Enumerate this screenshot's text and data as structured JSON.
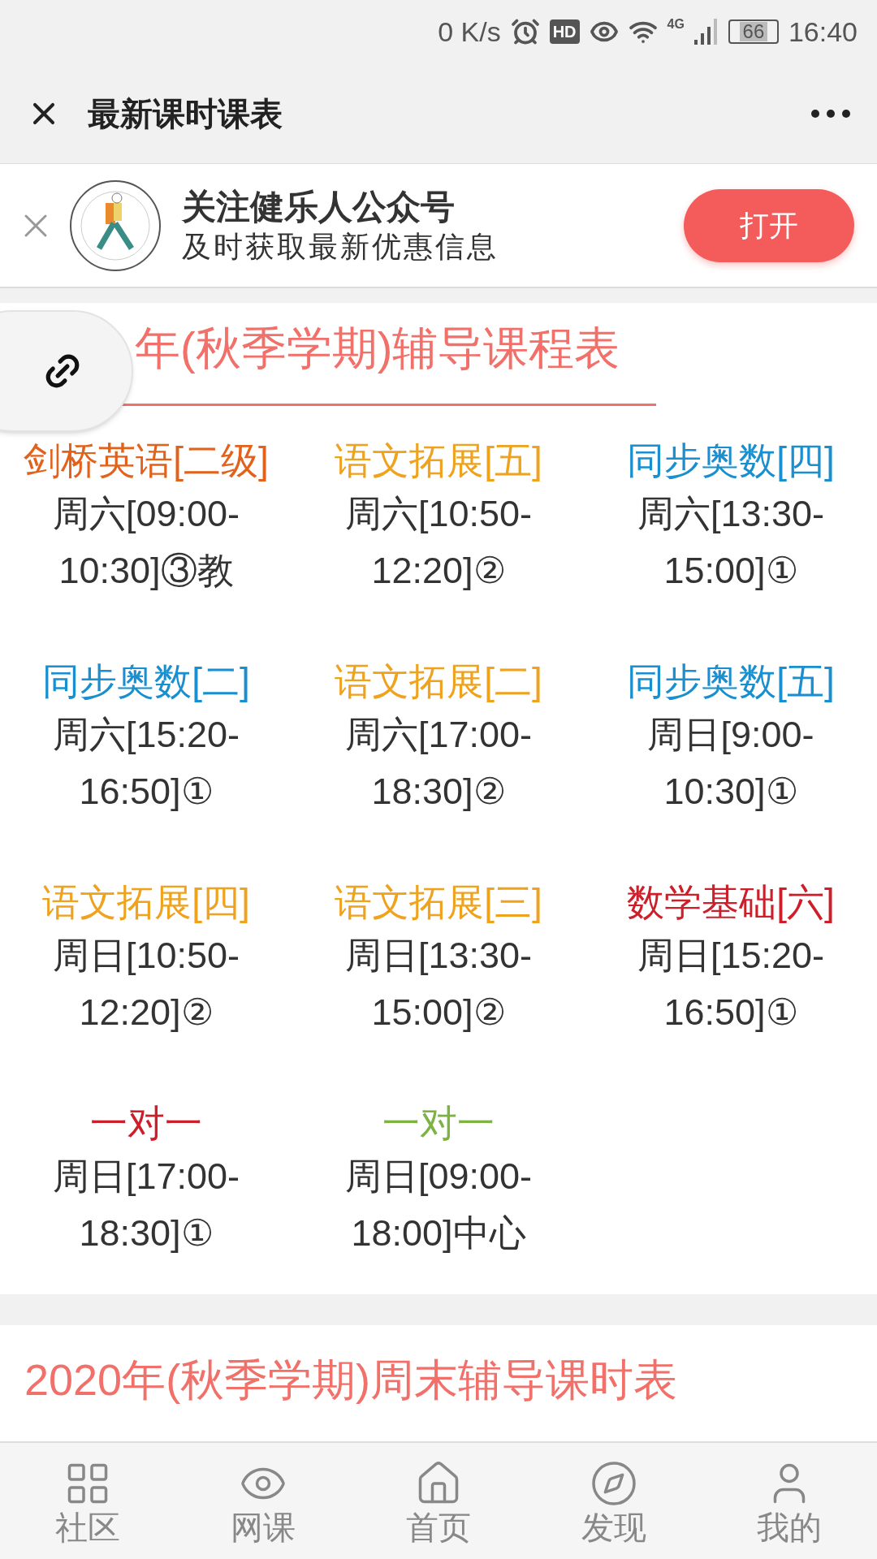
{
  "status_bar": {
    "speed": "0 K/s",
    "hd": "HD",
    "network": "4G",
    "battery": "66",
    "time": "16:40"
  },
  "title_bar": {
    "title": "最新课时课表"
  },
  "follow_banner": {
    "title": "关注健乐人公众号",
    "subtitle": "及时获取最新优惠信息",
    "button": "打开"
  },
  "schedule": {
    "heading": "年(秋季学期)辅导课程表",
    "courses": [
      {
        "name": "剑桥英语[二级]",
        "color": "#e2621b",
        "lines": [
          "周六[09:00-",
          "10:30]③教"
        ]
      },
      {
        "name": "语文拓展[五]",
        "color": "#eea21e",
        "lines": [
          "周六[10:50-",
          "12:20]②"
        ]
      },
      {
        "name": "同步奥数[四]",
        "color": "#1a8fd0",
        "lines": [
          "周六[13:30-",
          "15:00]①"
        ]
      },
      {
        "name": "同步奥数[二]",
        "color": "#1a8fd0",
        "lines": [
          "周六[15:20-",
          "16:50]①"
        ]
      },
      {
        "name": "语文拓展[二]",
        "color": "#eea21e",
        "lines": [
          "周六[17:00-",
          "18:30]②"
        ]
      },
      {
        "name": "同步奥数[五]",
        "color": "#1a8fd0",
        "lines": [
          "周日[9:00-",
          "10:30]①"
        ]
      },
      {
        "name": "语文拓展[四]",
        "color": "#eea21e",
        "lines": [
          "周日[10:50-",
          "12:20]②"
        ]
      },
      {
        "name": "语文拓展[三]",
        "color": "#eea21e",
        "lines": [
          "周日[13:30-",
          "15:00]②"
        ]
      },
      {
        "name": "数学基础[六]",
        "color": "#cc1f2a",
        "lines": [
          "周日[15:20-",
          "16:50]①"
        ]
      },
      {
        "name": "一对一",
        "color": "#cc1f2a",
        "lines": [
          "周日[17:00-",
          "18:30]①"
        ]
      },
      {
        "name": "一对一",
        "color": "#7cb342",
        "lines": [
          "周日[09:00-",
          "18:00]中心"
        ]
      }
    ]
  },
  "next_section": {
    "heading": "2020年(秋季学期)周末辅导课时表"
  },
  "bottom_nav": [
    {
      "kind": "grid",
      "label": "社区"
    },
    {
      "kind": "eye",
      "label": "网课"
    },
    {
      "kind": "home",
      "label": "首页"
    },
    {
      "kind": "compass",
      "label": "发现"
    },
    {
      "kind": "user",
      "label": "我的"
    }
  ]
}
